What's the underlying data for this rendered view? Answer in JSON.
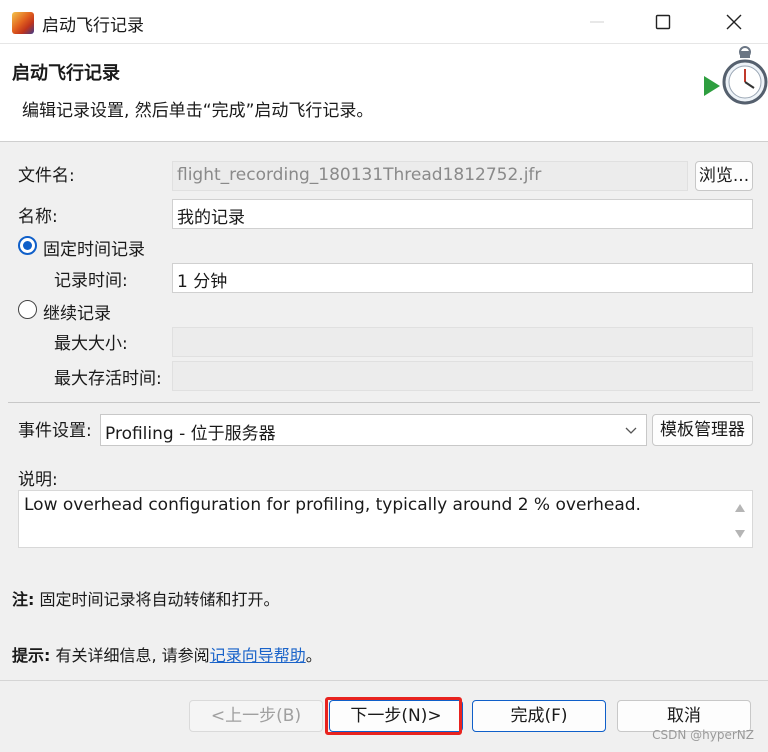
{
  "window": {
    "title": "启动飞行记录",
    "minimize_icon": "minimize-icon",
    "maximize_icon": "maximize-icon",
    "close_icon": "close-icon"
  },
  "header": {
    "title": "启动飞行记录",
    "description": "编辑记录设置, 然后单击“完成”启动飞行记录。",
    "icon": "stopwatch-play-icon"
  },
  "form": {
    "filename_label": "文件名:",
    "filename_value": "flight_recording_180131Thread1812752.jfr",
    "browse_label": "浏览...",
    "name_label": "名称:",
    "name_value": "我的记录",
    "fixed_radio_label": "固定时间记录",
    "fixed_selected": true,
    "duration_label": "记录时间:",
    "duration_value": "1 分钟",
    "continuous_radio_label": "继续记录",
    "max_size_label": "最大大小:",
    "max_size_value": "",
    "max_age_label": "最大存活时间:",
    "max_age_value": ""
  },
  "events": {
    "label": "事件设置:",
    "selected": "Profiling - 位于服务器",
    "template_manager_label": "模板管理器"
  },
  "description": {
    "label": "说明:",
    "text": "Low overhead configuration for profiling, typically around 2 % overhead."
  },
  "notes": {
    "note_prefix": "注:",
    "note_text": "固定时间记录将自动转储和打开。",
    "hint_prefix": "提示:",
    "hint_text": "有关详细信息, 请参阅",
    "hint_link": "记录向导帮助",
    "hint_suffix": "。"
  },
  "footer": {
    "back_label": "<上一步(B)",
    "next_label": "下一步(N)>",
    "finish_label": "完成(F)",
    "cancel_label": "取消"
  },
  "watermark": "CSDN @hyperNZ",
  "colors": {
    "accent": "#0f5fc9",
    "highlight": "#e8231f",
    "link": "#1a63c9"
  }
}
